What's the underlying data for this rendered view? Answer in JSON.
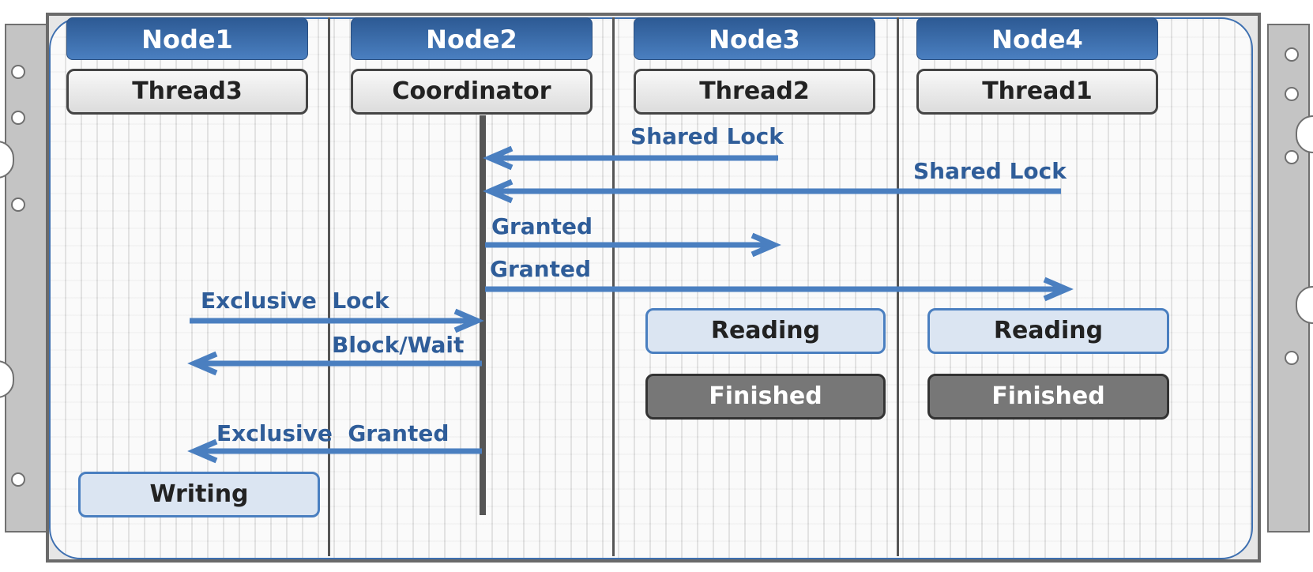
{
  "nodes": [
    {
      "name": "Node1",
      "thread": "Thread3"
    },
    {
      "name": "Node2",
      "thread": "Coordinator"
    },
    {
      "name": "Node3",
      "thread": "Thread2"
    },
    {
      "name": "Node4",
      "thread": "Thread1"
    }
  ],
  "messages": [
    {
      "label": "Shared Lock",
      "from": "Thread2",
      "to": "Coordinator"
    },
    {
      "label": "Shared Lock",
      "from": "Thread1",
      "to": "Coordinator"
    },
    {
      "label": "Granted",
      "from": "Coordinator",
      "to": "Thread2"
    },
    {
      "label": "Granted",
      "from": "Coordinator",
      "to": "Thread1"
    },
    {
      "label": "Exclusive  Lock",
      "from": "Thread3",
      "to": "Coordinator"
    },
    {
      "label": "Block/Wait",
      "from": "Coordinator",
      "to": "Thread3"
    },
    {
      "label": "Exclusive  Granted",
      "from": "Coordinator",
      "to": "Thread3"
    }
  ],
  "states": {
    "node1": [
      "Writing"
    ],
    "node3": [
      "Reading",
      "Finished"
    ],
    "node4": [
      "Reading",
      "Finished"
    ]
  },
  "colors": {
    "node_header": "#3d6fb0",
    "arrow": "#4a7fc0",
    "label": "#2f5d99",
    "reading_bg": "#dbe5f2",
    "finished_bg": "#777777"
  }
}
